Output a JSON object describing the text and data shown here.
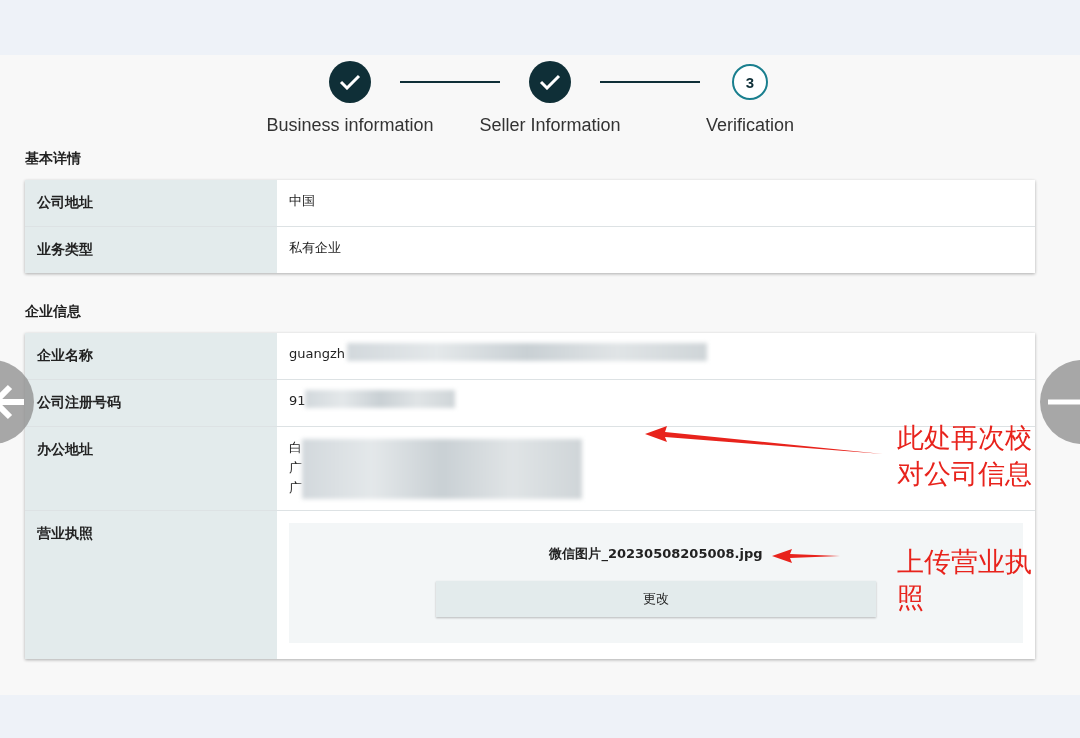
{
  "steps": [
    {
      "label": "Business information",
      "done": true
    },
    {
      "label": "Seller Information",
      "done": true
    },
    {
      "label": "Verification",
      "done": false,
      "number": "3"
    }
  ],
  "sections": [
    {
      "title": "基本详情",
      "rows": [
        {
          "kind": "text",
          "label": "公司地址",
          "lines": [
            "中国"
          ]
        },
        {
          "kind": "text",
          "label": "业务类型",
          "lines": [
            "私有企业"
          ]
        }
      ]
    },
    {
      "title": "企业信息",
      "rows": [
        {
          "kind": "text",
          "label": "企业名称",
          "lines": [
            "guangzh"
          ],
          "redacted": true
        },
        {
          "kind": "text",
          "label": "公司注册号码",
          "lines": [
            "91"
          ],
          "redacted": true
        },
        {
          "kind": "text",
          "label": "办公地址",
          "lines": [
            "白",
            "广",
            "广"
          ],
          "redacted": true
        },
        {
          "kind": "file",
          "label": "营业执照",
          "file_name": "微信图片_20230508205008.jpg",
          "button": "更改"
        }
      ]
    }
  ],
  "annotations": [
    {
      "text": "此处再次校对公司信息"
    },
    {
      "text": "上传营业执照"
    }
  ]
}
